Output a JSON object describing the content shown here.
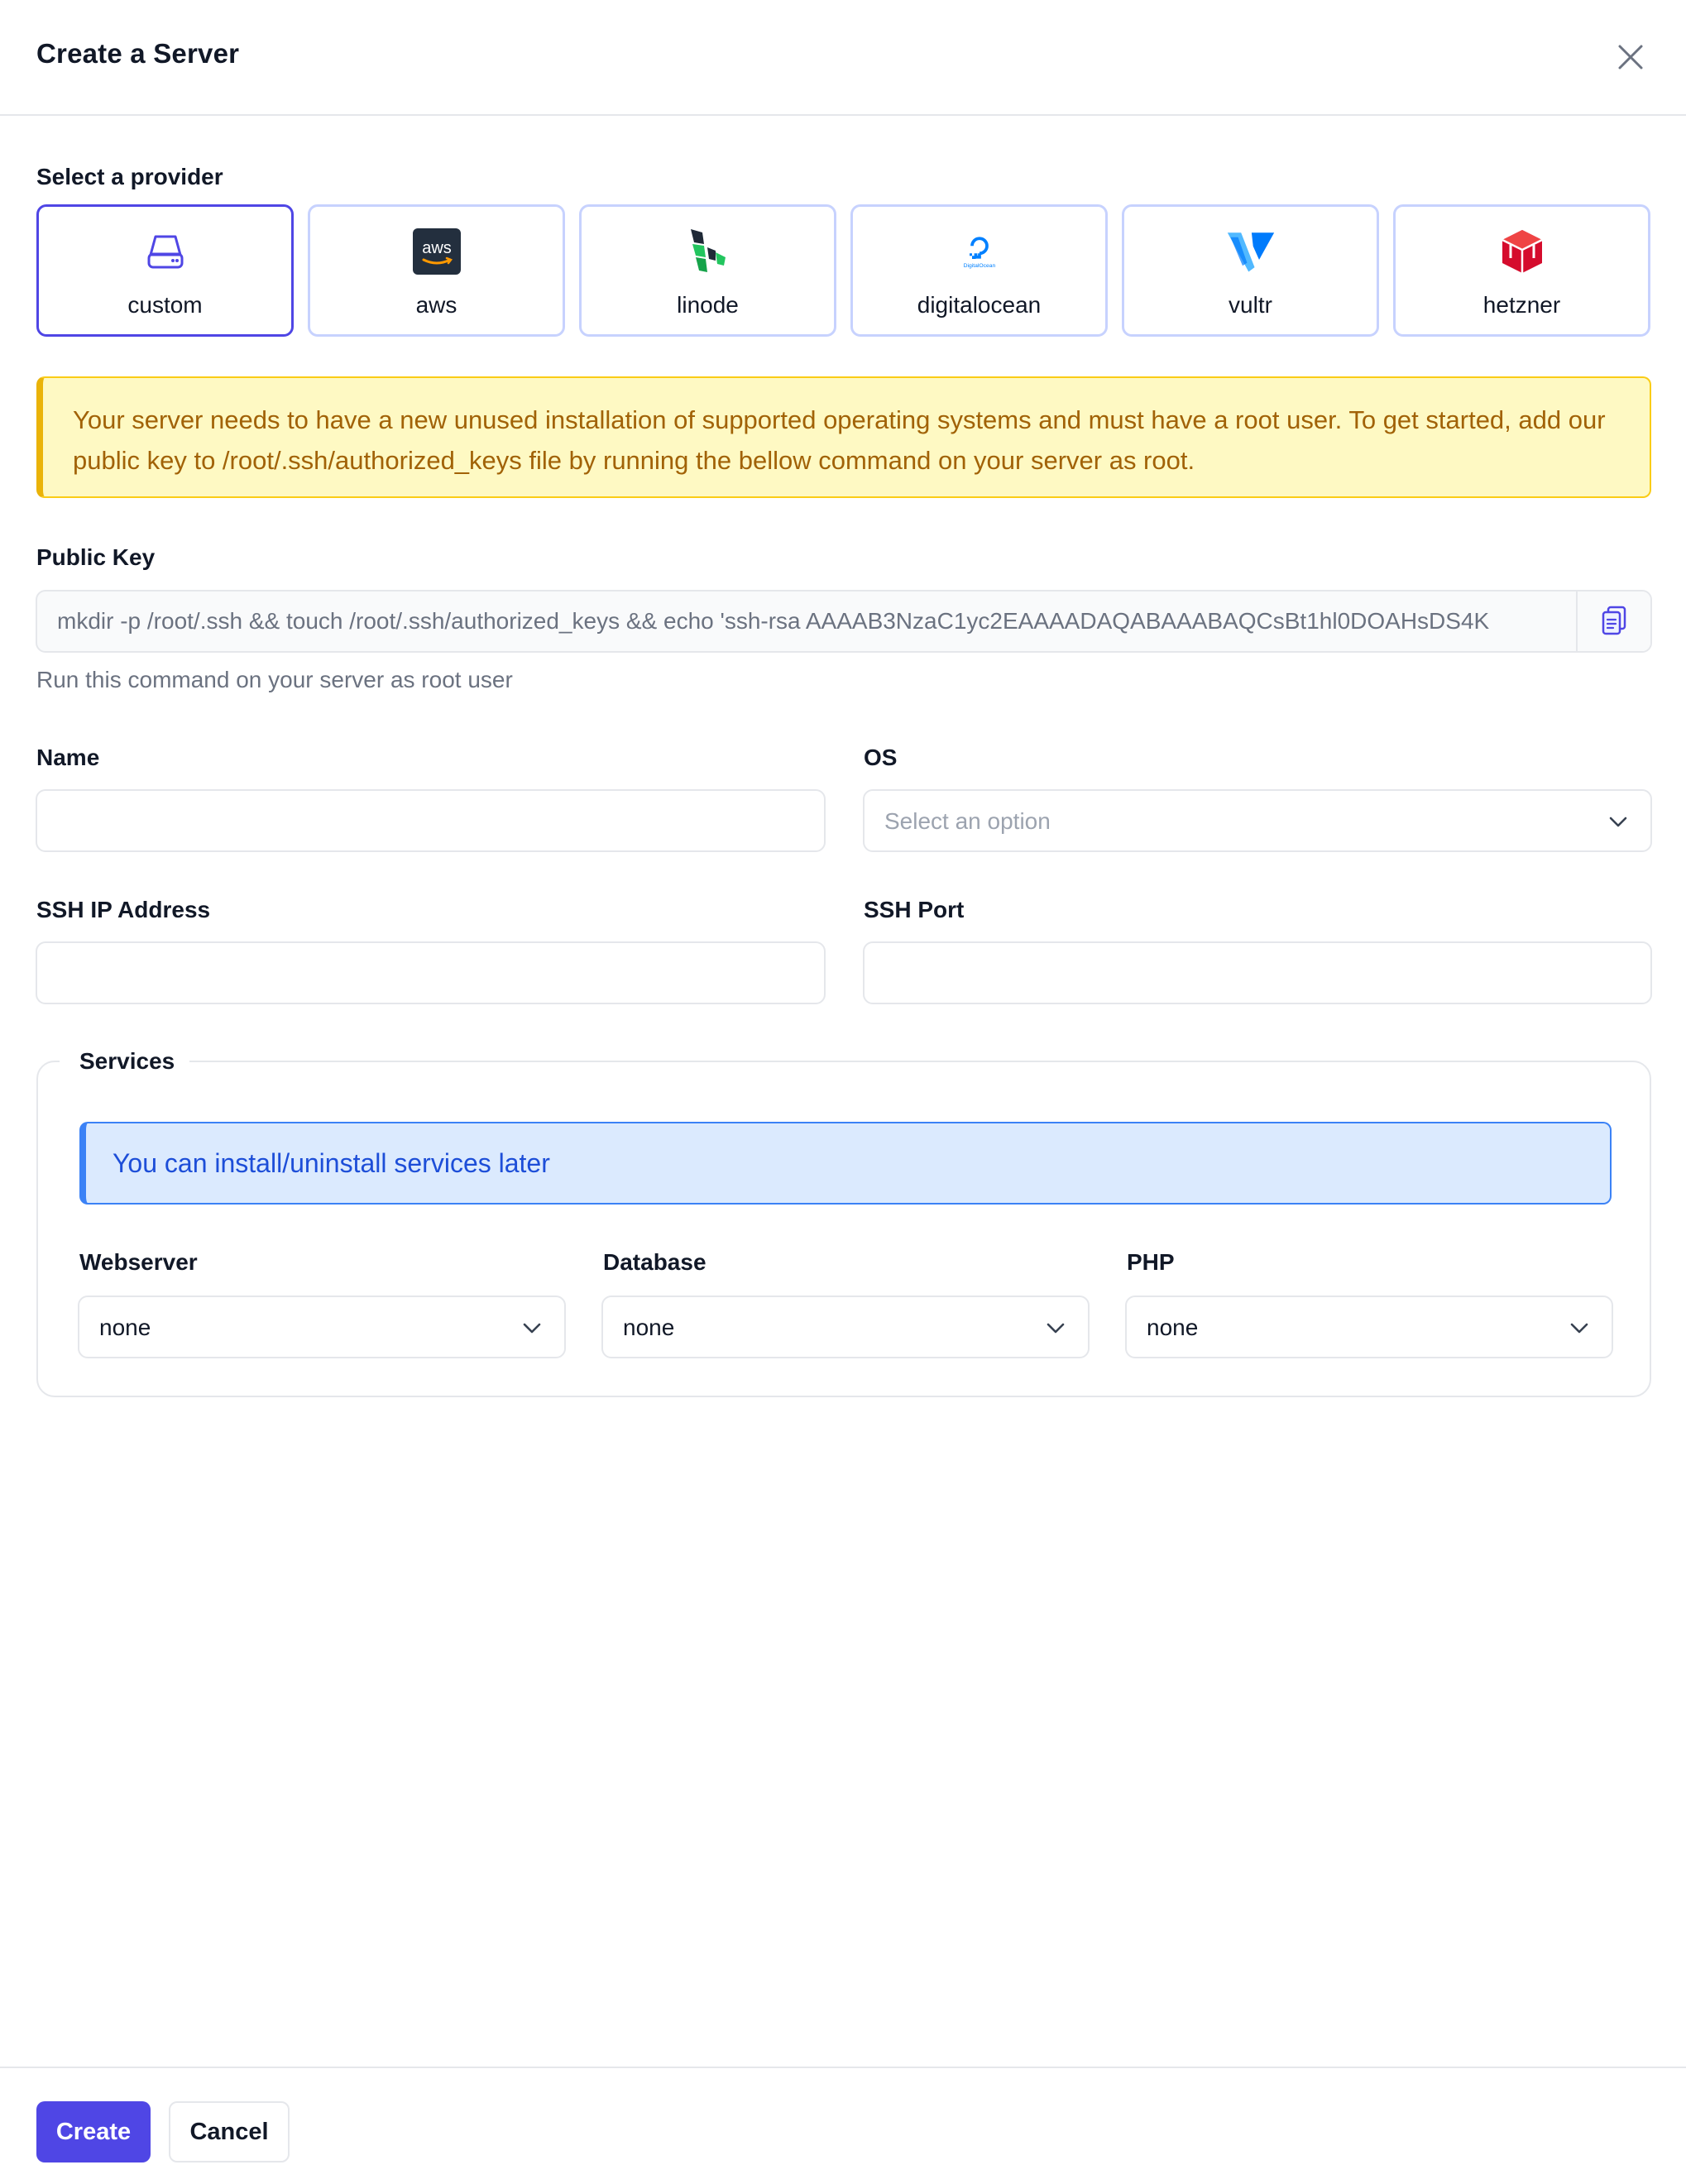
{
  "dialog": {
    "title": "Create a Server",
    "close_icon": "close-icon"
  },
  "provider": {
    "label": "Select a provider",
    "selected": "custom",
    "items": [
      {
        "label": "custom",
        "icon": "server-icon"
      },
      {
        "label": "aws",
        "icon": "aws-logo"
      },
      {
        "label": "linode",
        "icon": "linode-logo"
      },
      {
        "label": "digitalocean",
        "icon": "digitalocean-logo"
      },
      {
        "label": "vultr",
        "icon": "vultr-logo"
      },
      {
        "label": "hetzner",
        "icon": "hetzner-logo"
      }
    ]
  },
  "warning": {
    "text": "Your server needs to have a new unused installation of supported operating systems and must have a root user. To get started, add our public key to /root/.ssh/authorized_keys file by running the bellow command on your server as root."
  },
  "public_key": {
    "label": "Public Key",
    "value": "mkdir -p /root/.ssh && touch /root/.ssh/authorized_keys && echo 'ssh-rsa AAAAB3NzaC1yc2EAAAADAQABAAABAQCsBt1hl0DOAHsDS4K",
    "hint": "Run this command on your server as root user",
    "copy_icon": "clipboard-icon"
  },
  "fields": {
    "name": {
      "label": "Name",
      "value": ""
    },
    "os": {
      "label": "OS",
      "placeholder": "Select an option"
    },
    "ssh_ip": {
      "label": "SSH IP Address",
      "value": ""
    },
    "ssh_port": {
      "label": "SSH Port",
      "value": ""
    }
  },
  "services": {
    "legend": "Services",
    "info": "You can install/uninstall services later",
    "webserver": {
      "label": "Webserver",
      "value": "none"
    },
    "database": {
      "label": "Database",
      "value": "none"
    },
    "php": {
      "label": "PHP",
      "value": "none"
    }
  },
  "footer": {
    "create_label": "Create",
    "cancel_label": "Cancel"
  },
  "colors": {
    "accent": "#4f46e5",
    "warning_bg": "#fef9c3",
    "warning_text": "#a16207",
    "info_bg": "#dbeafe",
    "info_text": "#1d4ed8"
  }
}
